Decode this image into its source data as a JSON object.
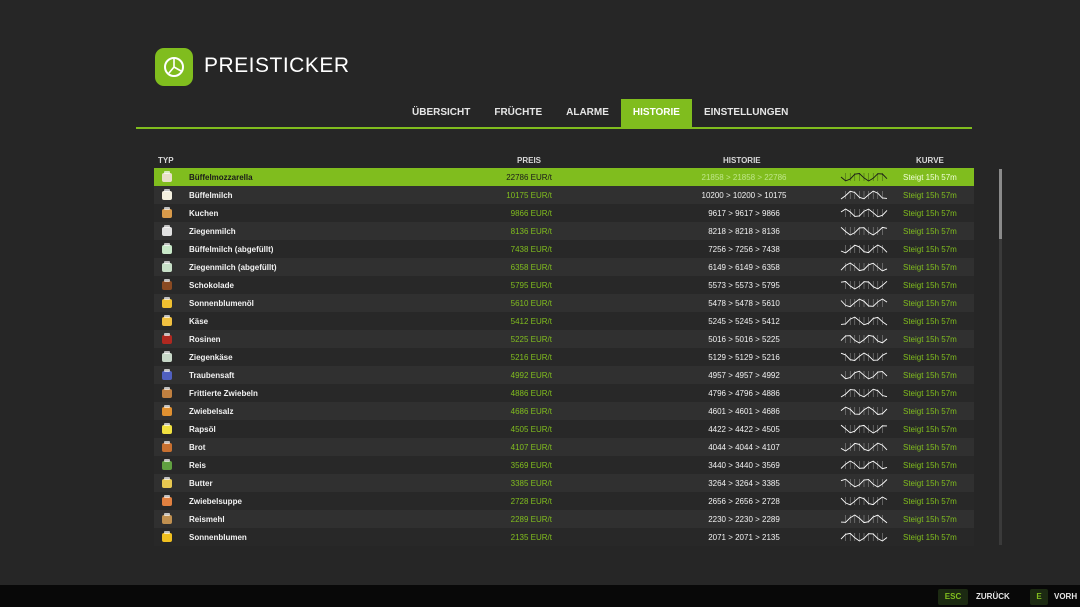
{
  "header": {
    "title": "PREISTICKER"
  },
  "tabs": [
    "ÜBERSICHT",
    "FRÜCHTE",
    "ALARME",
    "HISTORIE",
    "EINSTELLUNGEN"
  ],
  "active_tab": 3,
  "columns": {
    "typ": "TYP",
    "preis": "PREIS",
    "historie": "HISTORIE",
    "kurve": "KURVE"
  },
  "colors": {
    "accent": "#80bd1e",
    "background": "#262626"
  },
  "rows": [
    {
      "name": "Büffelmozzarella",
      "price": "22786 EUR/t",
      "history": "21858 > 21858 > 22786",
      "trend": "Steigt 15h 57m",
      "icon": "mozzarella-icon",
      "selected": true
    },
    {
      "name": "Büffelmilch",
      "price": "10175 EUR/t",
      "history": "10200 > 10200 > 10175",
      "trend": "Steigt 15h 57m",
      "icon": "buffalo-milk-icon"
    },
    {
      "name": "Kuchen",
      "price": "9866 EUR/t",
      "history": "9617 > 9617 > 9866",
      "trend": "Steigt 15h 57m",
      "icon": "cake-icon"
    },
    {
      "name": "Ziegenmilch",
      "price": "8136 EUR/t",
      "history": "8218 > 8218 > 8136",
      "trend": "Steigt 15h 57m",
      "icon": "goat-milk-icon"
    },
    {
      "name": "Büffelmilch (abgefüllt)",
      "price": "7438 EUR/t",
      "history": "7256 > 7256 > 7438",
      "trend": "Steigt 15h 57m",
      "icon": "bottled-buffalo-milk-icon"
    },
    {
      "name": "Ziegenmilch (abgefüllt)",
      "price": "6358 EUR/t",
      "history": "6149 > 6149 > 6358",
      "trend": "Steigt 15h 57m",
      "icon": "bottled-goat-milk-icon"
    },
    {
      "name": "Schokolade",
      "price": "5795 EUR/t",
      "history": "5573 > 5573 > 5795",
      "trend": "Steigt 15h 57m",
      "icon": "chocolate-icon"
    },
    {
      "name": "Sonnenblumenöl",
      "price": "5610 EUR/t",
      "history": "5478 > 5478 > 5610",
      "trend": "Steigt 15h 57m",
      "icon": "sunflower-oil-icon"
    },
    {
      "name": "Käse",
      "price": "5412 EUR/t",
      "history": "5245 > 5245 > 5412",
      "trend": "Steigt 15h 57m",
      "icon": "cheese-icon"
    },
    {
      "name": "Rosinen",
      "price": "5225 EUR/t",
      "history": "5016 > 5016 > 5225",
      "trend": "Steigt 15h 57m",
      "icon": "raisins-icon"
    },
    {
      "name": "Ziegenkäse",
      "price": "5216 EUR/t",
      "history": "5129 > 5129 > 5216",
      "trend": "Steigt 15h 57m",
      "icon": "goat-cheese-icon"
    },
    {
      "name": "Traubensaft",
      "price": "4992 EUR/t",
      "history": "4957 > 4957 > 4992",
      "trend": "Steigt 15h 57m",
      "icon": "grape-juice-icon"
    },
    {
      "name": "Frittierte Zwiebeln",
      "price": "4886 EUR/t",
      "history": "4796 > 4796 > 4886",
      "trend": "Steigt 15h 57m",
      "icon": "fried-onions-icon"
    },
    {
      "name": "Zwiebelsalz",
      "price": "4686 EUR/t",
      "history": "4601 > 4601 > 4686",
      "trend": "Steigt 15h 57m",
      "icon": "onion-salt-icon"
    },
    {
      "name": "Rapsöl",
      "price": "4505 EUR/t",
      "history": "4422 > 4422 > 4505",
      "trend": "Steigt 15h 57m",
      "icon": "canola-oil-icon"
    },
    {
      "name": "Brot",
      "price": "4107 EUR/t",
      "history": "4044 > 4044 > 4107",
      "trend": "Steigt 15h 57m",
      "icon": "bread-icon"
    },
    {
      "name": "Reis",
      "price": "3569 EUR/t",
      "history": "3440 > 3440 > 3569",
      "trend": "Steigt 15h 57m",
      "icon": "rice-icon"
    },
    {
      "name": "Butter",
      "price": "3385 EUR/t",
      "history": "3264 > 3264 > 3385",
      "trend": "Steigt 15h 57m",
      "icon": "butter-icon"
    },
    {
      "name": "Zwiebelsuppe",
      "price": "2728 EUR/t",
      "history": "2656 > 2656 > 2728",
      "trend": "Steigt 15h 57m",
      "icon": "onion-soup-icon"
    },
    {
      "name": "Reismehl",
      "price": "2289 EUR/t",
      "history": "2230 > 2230 > 2289",
      "trend": "Steigt 15h 57m",
      "icon": "rice-flour-icon"
    },
    {
      "name": "Sonnenblumen",
      "price": "2135 EUR/t",
      "history": "2071 > 2071 > 2135",
      "trend": "Steigt 15h 57m",
      "icon": "sunflower-icon"
    }
  ],
  "footer": {
    "back_key": "ESC",
    "back_label": "ZURÜCK",
    "next_key": "E",
    "next_label": "VORH"
  }
}
